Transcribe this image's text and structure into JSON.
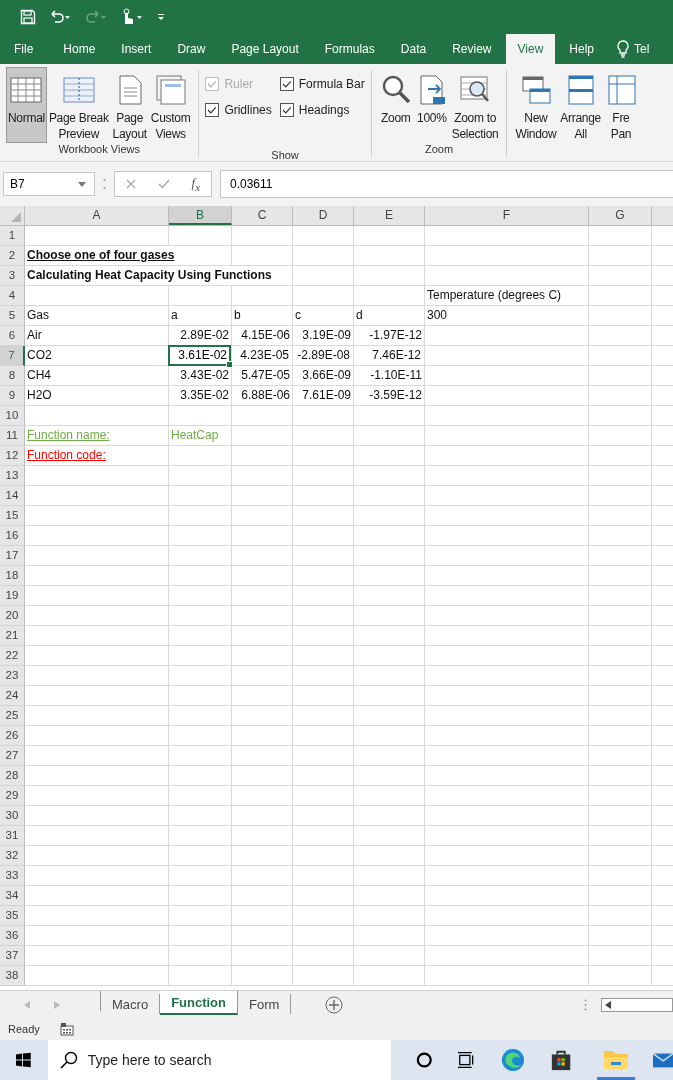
{
  "ribbon_tabs": [
    {
      "label": "File",
      "selected": false
    },
    {
      "label": "Home",
      "selected": false
    },
    {
      "label": "Insert",
      "selected": false
    },
    {
      "label": "Draw",
      "selected": false
    },
    {
      "label": "Page Layout",
      "selected": false
    },
    {
      "label": "Formulas",
      "selected": false
    },
    {
      "label": "Data",
      "selected": false
    },
    {
      "label": "Review",
      "selected": false
    },
    {
      "label": "View",
      "selected": true
    },
    {
      "label": "Help",
      "selected": false
    }
  ],
  "tell_me": "Tel",
  "workbook_views": {
    "label": "Workbook Views",
    "buttons": [
      {
        "kind": "normal",
        "lines": [
          "Normal"
        ],
        "selected": true
      },
      {
        "kind": "page-break",
        "lines": [
          "Page Break",
          "Preview"
        ],
        "selected": false
      },
      {
        "kind": "page-layout",
        "lines": [
          "Page",
          "Layout"
        ],
        "selected": false
      },
      {
        "kind": "custom-views",
        "lines": [
          "Custom",
          "Views"
        ],
        "selected": false
      }
    ]
  },
  "show": {
    "label": "Show",
    "options": [
      {
        "label": "Ruler",
        "checked": true,
        "disabled": true
      },
      {
        "label": "Formula Bar",
        "checked": true,
        "disabled": false
      },
      {
        "label": "Gridlines",
        "checked": true,
        "disabled": false
      },
      {
        "label": "Headings",
        "checked": true,
        "disabled": false
      }
    ]
  },
  "zoom": {
    "label": "Zoom",
    "buttons": [
      {
        "kind": "zoom",
        "lines": [
          "Zoom"
        ]
      },
      {
        "kind": "hundred",
        "lines": [
          "100%"
        ]
      },
      {
        "kind": "zoom-selection",
        "lines": [
          "Zoom to",
          "Selection"
        ]
      }
    ]
  },
  "window_group": {
    "buttons": [
      {
        "kind": "new-window",
        "lines": [
          "New",
          "Window"
        ]
      },
      {
        "kind": "arrange",
        "lines": [
          "Arrange",
          "All"
        ]
      },
      {
        "kind": "freeze",
        "lines": [
          "Fre",
          "Pan"
        ]
      }
    ]
  },
  "formula_bar": {
    "name_box": "B7",
    "function_label": "f$_{x}$",
    "value": "0.03611"
  },
  "columns": [
    {
      "label": "A",
      "selected": false
    },
    {
      "label": "B",
      "selected": true
    },
    {
      "label": "C",
      "selected": false
    },
    {
      "label": "D",
      "selected": false
    },
    {
      "label": "E",
      "selected": false
    },
    {
      "label": "F",
      "selected": false
    },
    {
      "label": "G",
      "selected": false
    }
  ],
  "rows": [
    {
      "number": "1",
      "selected": false
    },
    {
      "number": "2",
      "selected": false,
      "cells": {
        "A": {
          "text": "Choose one of four gases",
          "kind": "heading"
        }
      }
    },
    {
      "number": "3",
      "selected": false,
      "cells": {
        "A": {
          "text": "Calculating Heat Capacity Using Functions",
          "kind": "bold"
        }
      }
    },
    {
      "number": "4",
      "selected": false,
      "cells": {
        "F": {
          "text": "Temperature (degrees C)",
          "kind": "text"
        }
      }
    },
    {
      "number": "5",
      "selected": false,
      "cells": {
        "A": {
          "text": "Gas",
          "kind": "text"
        },
        "B": {
          "text": "a",
          "kind": "text"
        },
        "C": {
          "text": "b",
          "kind": "text"
        },
        "D": {
          "text": "c",
          "kind": "text"
        },
        "E": {
          "text": "d",
          "kind": "text"
        },
        "F": {
          "text": "300",
          "kind": "text"
        }
      }
    },
    {
      "number": "6",
      "selected": false,
      "cells": {
        "A": {
          "text": "Air",
          "kind": "text"
        },
        "B": {
          "text": "2.89E-02",
          "kind": "number"
        },
        "C": {
          "text": "4.15E-06",
          "kind": "number"
        },
        "D": {
          "text": "3.19E-09",
          "kind": "number"
        },
        "E": {
          "text": "-1.97E-12",
          "kind": "number"
        }
      }
    },
    {
      "number": "7",
      "selected": true,
      "cells": {
        "A": {
          "text": "CO2",
          "kind": "text"
        },
        "B": {
          "text": "3.61E-02",
          "kind": "number",
          "selected": true
        },
        "C": {
          "text": "4.23E-05",
          "kind": "number"
        },
        "D": {
          "text": "-2.89E-08",
          "kind": "number"
        },
        "E": {
          "text": "7.46E-12",
          "kind": "number"
        }
      }
    },
    {
      "number": "8",
      "selected": false,
      "cells": {
        "A": {
          "text": "CH4",
          "kind": "text"
        },
        "B": {
          "text": "3.43E-02",
          "kind": "number"
        },
        "C": {
          "text": "5.47E-05",
          "kind": "number"
        },
        "D": {
          "text": "3.66E-09",
          "kind": "number"
        },
        "E": {
          "text": "-1.10E-11",
          "kind": "number"
        }
      }
    },
    {
      "number": "9",
      "selected": false,
      "cells": {
        "A": {
          "text": "H2O",
          "kind": "text"
        },
        "B": {
          "text": "3.35E-02",
          "kind": "number"
        },
        "C": {
          "text": "6.88E-06",
          "kind": "number"
        },
        "D": {
          "text": "7.61E-09",
          "kind": "number"
        },
        "E": {
          "text": "-3.59E-12",
          "kind": "number"
        }
      }
    },
    {
      "number": "10",
      "selected": false
    },
    {
      "number": "11",
      "selected": false,
      "cells": {
        "A": {
          "text": "Function name:",
          "kind": "green-underline"
        },
        "B": {
          "text": "HeatCap",
          "kind": "green"
        }
      }
    },
    {
      "number": "12",
      "selected": false,
      "cells": {
        "A": {
          "text": "Function code:",
          "kind": "red-underline"
        }
      }
    },
    {
      "number": "13",
      "selected": false
    },
    {
      "number": "14",
      "selected": false
    },
    {
      "number": "15",
      "selected": false
    },
    {
      "number": "16",
      "selected": false
    },
    {
      "number": "17",
      "selected": false
    },
    {
      "number": "18",
      "selected": false
    },
    {
      "number": "19",
      "selected": false
    },
    {
      "number": "20",
      "selected": false
    },
    {
      "number": "21",
      "selected": false
    },
    {
      "number": "22",
      "selected": false
    },
    {
      "number": "23",
      "selected": false
    },
    {
      "number": "24",
      "selected": false
    },
    {
      "number": "25",
      "selected": false
    },
    {
      "number": "26",
      "selected": false
    },
    {
      "number": "27",
      "selected": false
    },
    {
      "number": "28",
      "selected": false
    },
    {
      "number": "29",
      "selected": false
    },
    {
      "number": "30",
      "selected": false
    },
    {
      "number": "31",
      "selected": false
    },
    {
      "number": "32",
      "selected": false
    },
    {
      "number": "33",
      "selected": false
    },
    {
      "number": "34",
      "selected": false
    },
    {
      "number": "35",
      "selected": false
    },
    {
      "number": "36",
      "selected": false
    },
    {
      "number": "37",
      "selected": false
    },
    {
      "number": "38",
      "selected": false
    }
  ],
  "sheet_tabs": [
    {
      "label": "Macro",
      "selected": false
    },
    {
      "label": "Function",
      "selected": true
    },
    {
      "label": "Form",
      "selected": false
    }
  ],
  "status_bar": {
    "text": "Ready"
  },
  "taskbar": {
    "search_placeholder": "Type here to search"
  }
}
